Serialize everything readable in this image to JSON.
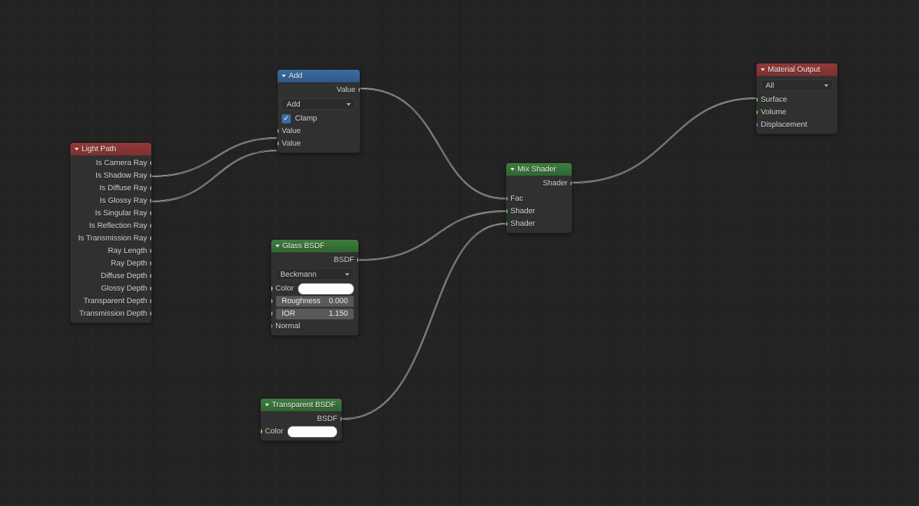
{
  "lightpath": {
    "title": "Light Path",
    "outputs": [
      "Is Camera Ray",
      "Is Shadow Ray",
      "Is Diffuse Ray",
      "Is Glossy Ray",
      "Is Singular Ray",
      "Is Reflection Ray",
      "Is Transmission Ray",
      "Ray Length",
      "Ray Depth",
      "Diffuse Depth",
      "Glossy Depth",
      "Transparent Depth",
      "Transmission Depth"
    ]
  },
  "add": {
    "title": "Add",
    "out_value": "Value",
    "mode": "Add",
    "clamp": "Clamp",
    "in_value1": "Value",
    "in_value2": "Value"
  },
  "glass": {
    "title": "Glass BSDF",
    "out_bsdf": "BSDF",
    "distribution": "Beckmann",
    "color_label": "Color",
    "roughness_label": "Roughness",
    "roughness_value": "0.000",
    "ior_label": "IOR",
    "ior_value": "1.150",
    "normal_label": "Normal"
  },
  "transparent": {
    "title": "Transparent BSDF",
    "out_bsdf": "BSDF",
    "color_label": "Color"
  },
  "mix": {
    "title": "Mix Shader",
    "out_shader": "Shader",
    "fac": "Fac",
    "shader1": "Shader",
    "shader2": "Shader"
  },
  "output": {
    "title": "Material Output",
    "target": "All",
    "surface": "Surface",
    "volume": "Volume",
    "displacement": "Displacement"
  }
}
